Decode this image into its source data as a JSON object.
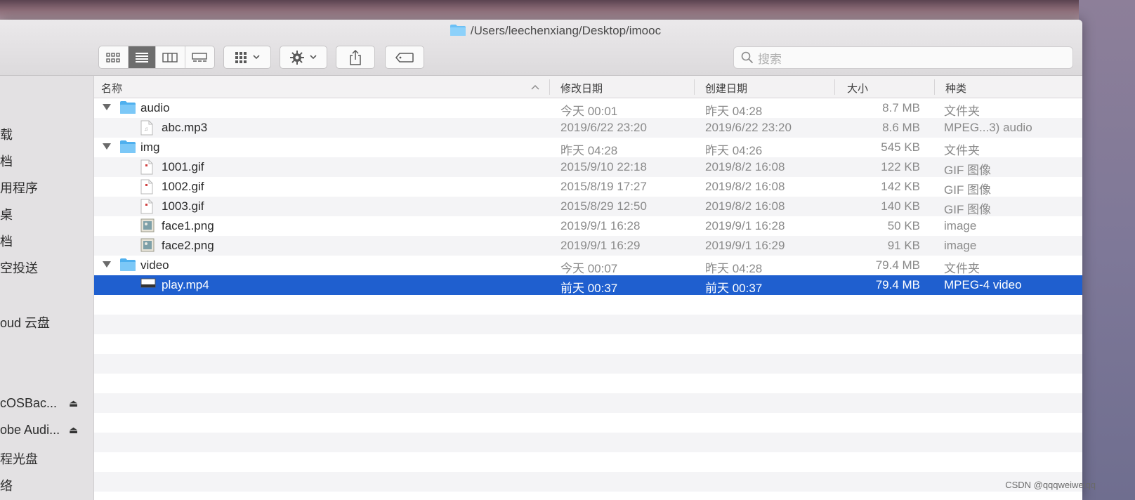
{
  "window": {
    "title": "/Users/leechenxiang/Desktop/imooc"
  },
  "toolbar": {
    "view_icon": "icon-view-button",
    "list_view": "list-view-button",
    "column_view": "column-view-button",
    "gallery_view": "gallery-view-button",
    "group_button": "group-by-button",
    "action_button": "action-gear-button",
    "share_button": "share-button",
    "tag_button": "tag-button"
  },
  "search": {
    "placeholder": "搜索"
  },
  "sidebar": {
    "items": [
      {
        "label": "载"
      },
      {
        "label": "档"
      },
      {
        "label": "用程序"
      },
      {
        "label": "桌"
      },
      {
        "label": "档"
      },
      {
        "label": "空投送"
      },
      {
        "label": "oud 云盘"
      },
      {
        "label": "cOSBac...",
        "eject": "⏏"
      },
      {
        "label": "obe Audi...",
        "eject": "⏏"
      },
      {
        "label": "程光盘"
      },
      {
        "label": "络"
      }
    ]
  },
  "columns": {
    "name": "名称",
    "modified": "修改日期",
    "created": "创建日期",
    "size": "大小",
    "kind": "种类"
  },
  "files": [
    {
      "name": "audio",
      "modified": "今天 00:01",
      "created": "昨天 04:28",
      "size": "8.7 MB",
      "kind": "文件夹",
      "type": "folder",
      "level": 0
    },
    {
      "name": "abc.mp3",
      "modified": "2019/6/22 23:20",
      "created": "2019/6/22 23:20",
      "size": "8.6 MB",
      "kind": "MPEG...3) audio",
      "type": "audio",
      "level": 1
    },
    {
      "name": "img",
      "modified": "昨天 04:28",
      "created": "昨天 04:26",
      "size": "545 KB",
      "kind": "文件夹",
      "type": "folder",
      "level": 0
    },
    {
      "name": "1001.gif",
      "modified": "2015/9/10 22:18",
      "created": "2019/8/2 16:08",
      "size": "122 KB",
      "kind": "GIF 图像",
      "type": "gif",
      "level": 1
    },
    {
      "name": "1002.gif",
      "modified": "2015/8/19 17:27",
      "created": "2019/8/2 16:08",
      "size": "142 KB",
      "kind": "GIF 图像",
      "type": "gif",
      "level": 1
    },
    {
      "name": "1003.gif",
      "modified": "2015/8/29 12:50",
      "created": "2019/8/2 16:08",
      "size": "140 KB",
      "kind": "GIF 图像",
      "type": "gif",
      "level": 1
    },
    {
      "name": "face1.png",
      "modified": "2019/9/1 16:28",
      "created": "2019/9/1 16:28",
      "size": "50 KB",
      "kind": "image",
      "type": "png",
      "level": 1
    },
    {
      "name": "face2.png",
      "modified": "2019/9/1 16:29",
      "created": "2019/9/1 16:29",
      "size": "91 KB",
      "kind": "image",
      "type": "png",
      "level": 1
    },
    {
      "name": "video",
      "modified": "今天 00:07",
      "created": "昨天 04:28",
      "size": "79.4 MB",
      "kind": "文件夹",
      "type": "folder",
      "level": 0
    },
    {
      "name": "play.mp4",
      "modified": "前天 00:37",
      "created": "前天 00:37",
      "size": "79.4 MB",
      "kind": "MPEG-4 video",
      "type": "video",
      "level": 1,
      "selected": true
    }
  ],
  "watermark": "CSDN @qqqweiweiqq",
  "colors": {
    "selection": "#1f5fcf",
    "folder": "#5eb8f0"
  }
}
